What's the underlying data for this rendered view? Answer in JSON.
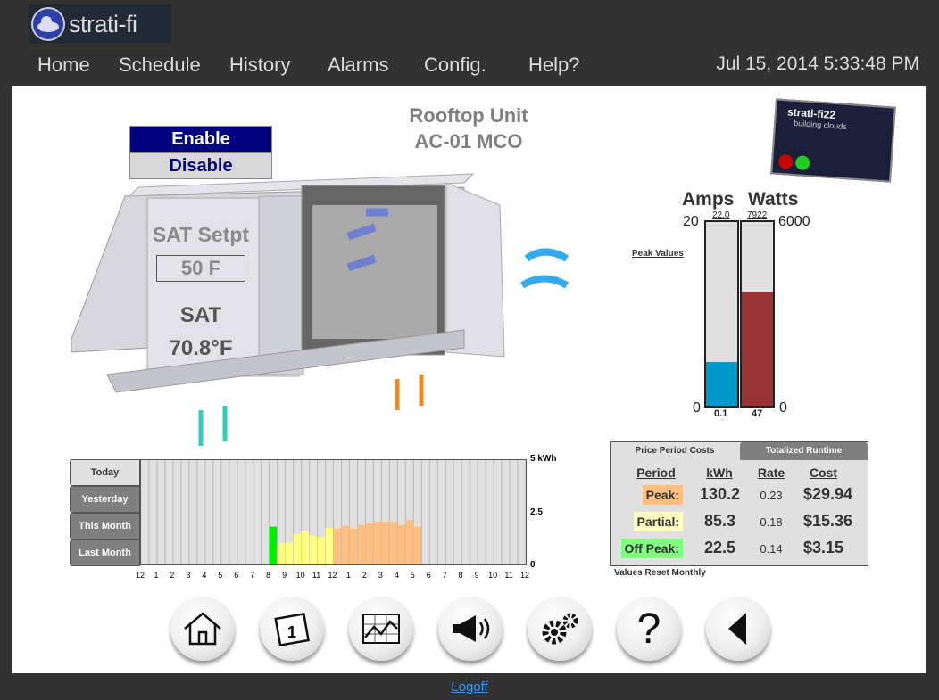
{
  "app": {
    "logo_text": "strati-fi",
    "datetime": "Jul 15, 2014 5:33:48 PM"
  },
  "nav": [
    {
      "label": "Home"
    },
    {
      "label": "Schedule"
    },
    {
      "label": "History"
    },
    {
      "label": "Alarms"
    },
    {
      "label": "Config."
    },
    {
      "label": "Help?"
    }
  ],
  "unit": {
    "title1": "Rooftop Unit",
    "title2": "AC-01  MCO",
    "enable_label": "Enable",
    "disable_label": "Disable",
    "setpoint_label": "SAT Setpt",
    "setpoint_value": "50 F",
    "sat_label": "SAT",
    "sat_value": "70.8°F"
  },
  "device": {
    "brand": "strati-fi22",
    "tagline": "building clouds"
  },
  "gauges": {
    "amps_label": "Amps",
    "watts_label": "Watts",
    "amps_max": "20",
    "amps_min": "0",
    "watts_max": "6000",
    "watts_min": "0",
    "amps_peak": "22.0",
    "watts_peak": "7922",
    "amps_now": "0.1",
    "watts_now": "47",
    "peak_link": "Peak Values",
    "amps_fill_fraction": 0.24,
    "watts_fill_fraction": 0.62,
    "amps_color": "#0099cc",
    "watts_color": "#993333"
  },
  "chart_tabs": [
    {
      "label": "Today"
    },
    {
      "label": "Yesterday"
    },
    {
      "label": "This Month"
    },
    {
      "label": "Last Month"
    }
  ],
  "chart_data": {
    "type": "bar",
    "ylabel_max": "5 kWh",
    "ylim": [
      0,
      5
    ],
    "yticks": [
      "5 kWh",
      "2.5",
      "0"
    ],
    "xtick_labels": [
      "12",
      "1",
      "2",
      "3",
      "4",
      "5",
      "6",
      "7",
      "8",
      "9",
      "10",
      "11",
      "12",
      "1",
      "2",
      "3",
      "4",
      "5",
      "6",
      "7",
      "8",
      "9",
      "10",
      "11",
      "12"
    ],
    "slots_per_hour": 2,
    "values": [
      0,
      0,
      0,
      0,
      0,
      0,
      0,
      0,
      0,
      0,
      0,
      0,
      0,
      0,
      0,
      0,
      1.81,
      1.0,
      1.05,
      1.47,
      1.6,
      1.39,
      1.3,
      1.76,
      1.72,
      1.85,
      1.72,
      1.89,
      1.97,
      2.06,
      2.06,
      2.06,
      1.89,
      2.14,
      1.81,
      0,
      0,
      0,
      0,
      0,
      0,
      0,
      0,
      0,
      0,
      0,
      0,
      0
    ],
    "period_colors": {
      "offpeak": "#00ee00",
      "partial": "#ffff80",
      "peak": "#ffbf80"
    },
    "periods": [
      "none",
      "none",
      "none",
      "none",
      "none",
      "none",
      "none",
      "none",
      "none",
      "none",
      "none",
      "none",
      "none",
      "none",
      "none",
      "none",
      "offpeak",
      "partial",
      "partial",
      "partial",
      "partial",
      "partial",
      "partial",
      "partial",
      "peak",
      "peak",
      "peak",
      "peak",
      "peak",
      "peak",
      "peak",
      "peak",
      "peak",
      "peak",
      "peak",
      "none",
      "none",
      "none",
      "none",
      "none",
      "none",
      "none",
      "none",
      "none",
      "none",
      "none",
      "none",
      "none"
    ]
  },
  "costs": {
    "tab_active": "Price Period Costs",
    "tab_other": "Totalized Runtime",
    "headers": [
      "Period",
      "kWh",
      "Rate",
      "Cost"
    ],
    "rows": [
      {
        "period": "Peak:",
        "kwh": "130.2",
        "rate": "0.23",
        "cost": "$29.94",
        "color": "#ffbf80"
      },
      {
        "period": "Partial:",
        "kwh": "85.3",
        "rate": "0.18",
        "cost": "$15.36",
        "color": "#ffffc0"
      },
      {
        "period": "Off Peak:",
        "kwh": "22.5",
        "rate": "0.14",
        "cost": "$3.15",
        "color": "#80ff80"
      }
    ],
    "note": "Values Reset Monthly"
  },
  "bottom_nav": [
    {
      "icon": "home-icon"
    },
    {
      "icon": "calendar-icon"
    },
    {
      "icon": "chart-icon"
    },
    {
      "icon": "megaphone-icon"
    },
    {
      "icon": "gears-icon"
    },
    {
      "icon": "help-icon"
    },
    {
      "icon": "back-icon"
    }
  ],
  "footer": {
    "logoff": "Logoff"
  }
}
